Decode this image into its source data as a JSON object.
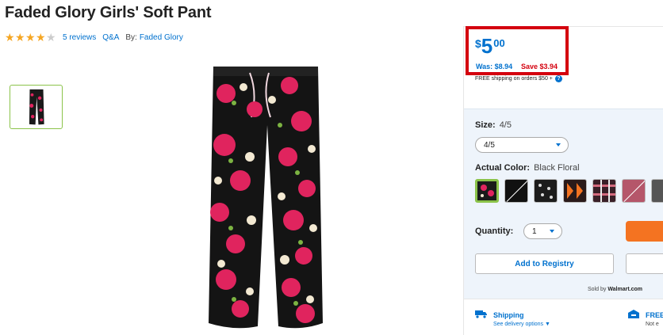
{
  "product": {
    "title": "Faded Glory Girls' Soft Pant",
    "rating": 4,
    "rating_max": 5,
    "reviews_link": "5 reviews",
    "qa_link": "Q&A",
    "by_label": "By:",
    "brand_link": "Faded Glory"
  },
  "pricing": {
    "currency": "$",
    "dollars": "5",
    "cents": "00",
    "was": "Was: $8.94",
    "save": "Save $3.94",
    "shipping_note": "FREE shipping on orders $50 +"
  },
  "options": {
    "size_label": "Size:",
    "size_value": "4/5",
    "size_select": "4/5",
    "color_label": "Actual Color:",
    "color_value": "Black Floral",
    "quantity_label": "Quantity:",
    "quantity_value": "1"
  },
  "actions": {
    "registry_button": "Add to Registry",
    "sold_by_prefix": "Sold by",
    "sold_by_seller": "Walmart.com"
  },
  "fulfillment": {
    "shipping_title": "Shipping",
    "shipping_sub": "See delivery options",
    "pickup_title": "FREE",
    "pickup_sub": "Not e"
  },
  "colors": {
    "accent_blue": "#0071ce",
    "save_red": "#d4000e",
    "highlight_red": "#d4000e",
    "selected_green": "#8bc34a",
    "add_to_cart_orange": "#f47321"
  },
  "swatch_icons": [
    "black-floral-swatch",
    "black-swatch-unavailable",
    "black-print-swatch",
    "orange-print-swatch",
    "plaid-swatch",
    "rose-swatch-unavailable",
    "gray-swatch"
  ]
}
